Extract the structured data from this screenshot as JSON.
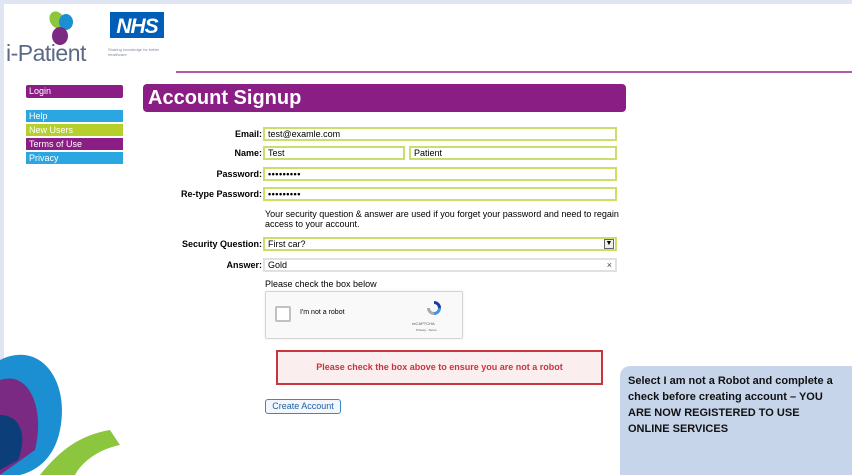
{
  "brand": {
    "logo_text": "i-Patient",
    "tagline": "Sharing knowledge for better healthcare",
    "nhs": "NHS"
  },
  "sidebar": {
    "items": [
      {
        "label": "Login"
      },
      {
        "label": "Help"
      },
      {
        "label": "New Users"
      },
      {
        "label": "Terms of Use"
      },
      {
        "label": "Privacy"
      }
    ]
  },
  "page": {
    "title": "Account Signup"
  },
  "form": {
    "email_label": "Email:",
    "email_value": "test@examle.com",
    "name_label": "Name:",
    "first_name_value": "Test",
    "last_name_value": "Patient",
    "password_label": "Password:",
    "password_value": "•••••••••",
    "retype_label": "Re-type Password:",
    "retype_value": "•••••••••",
    "security_note": "Your security question & answer are used if you forget your password and need to regain access to your account.",
    "question_label": "Security Question:",
    "question_value": "First car?",
    "answer_label": "Answer:",
    "answer_value": "Gold",
    "check_hint": "Please check the box below",
    "error_message": "Please check the box above to ensure you are not a robot",
    "submit_label": "Create Account"
  },
  "captcha": {
    "label": "I'm not a robot",
    "brand": "reCAPTCHA",
    "links": "Privacy - Terms"
  },
  "callout": {
    "text": "Select I am not a Robot and complete a check before creating account – YOU ARE NOW REGISTERED TO USE ONLINE SERVICES"
  },
  "colors": {
    "purple": "#8a1e84",
    "blue": "#2aa6e0",
    "green": "#b6cf2b",
    "field_border": "#c8df6a",
    "error": "#c8353d",
    "nhs_blue": "#005eb8"
  }
}
